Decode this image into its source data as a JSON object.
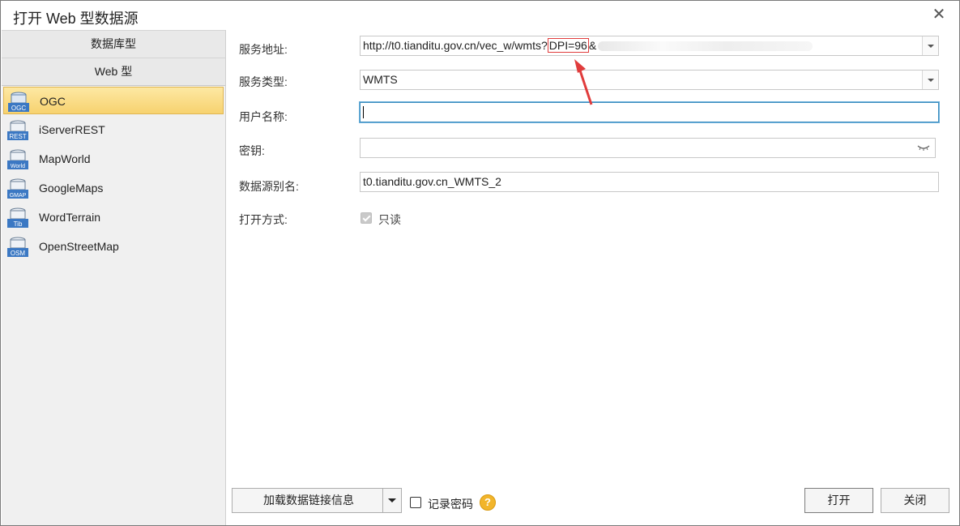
{
  "window": {
    "title": "打开 Web 型数据源"
  },
  "sidebar": {
    "header_db": "数据库型",
    "header_web": "Web 型",
    "items": [
      {
        "label": "OGC",
        "icon": "ogc-db-icon",
        "badge": "OGC",
        "active": true
      },
      {
        "label": "iServerREST",
        "icon": "rest-db-icon",
        "badge": "REST"
      },
      {
        "label": "MapWorld",
        "icon": "world-db-icon",
        "badge": "World"
      },
      {
        "label": "GoogleMaps",
        "icon": "gmap-db-icon",
        "badge": "GMAP"
      },
      {
        "label": "WordTerrain",
        "icon": "tib-db-icon",
        "badge": "Tib"
      },
      {
        "label": "OpenStreetMap",
        "icon": "osm-db-icon",
        "badge": "OSM"
      }
    ]
  },
  "form": {
    "url_label": "服务地址:",
    "url_value_prefix": "http://t0.tianditu.gov.cn/vec_w/wmts?",
    "url_value_highlight": "DPI=96",
    "url_value_suffix": "&",
    "type_label": "服务类型:",
    "type_value": "WMTS",
    "user_label": "用户名称:",
    "user_value": "",
    "key_label": "密钥:",
    "key_value": "",
    "alias_label": "数据源别名:",
    "alias_value": "t0.tianditu.gov.cn_WMTS_2",
    "open_mode_label": "打开方式:",
    "readonly_label": "只读"
  },
  "footer": {
    "load_button": "加载数据链接信息",
    "remember_label": "记录密码",
    "help": "?",
    "open_button": "打开",
    "close_button": "关闭"
  },
  "close_glyph": "✕",
  "colors": {
    "annotation": "#e03c3c",
    "active_item": "#f7d26f",
    "help_icon": "#f2b52b"
  }
}
